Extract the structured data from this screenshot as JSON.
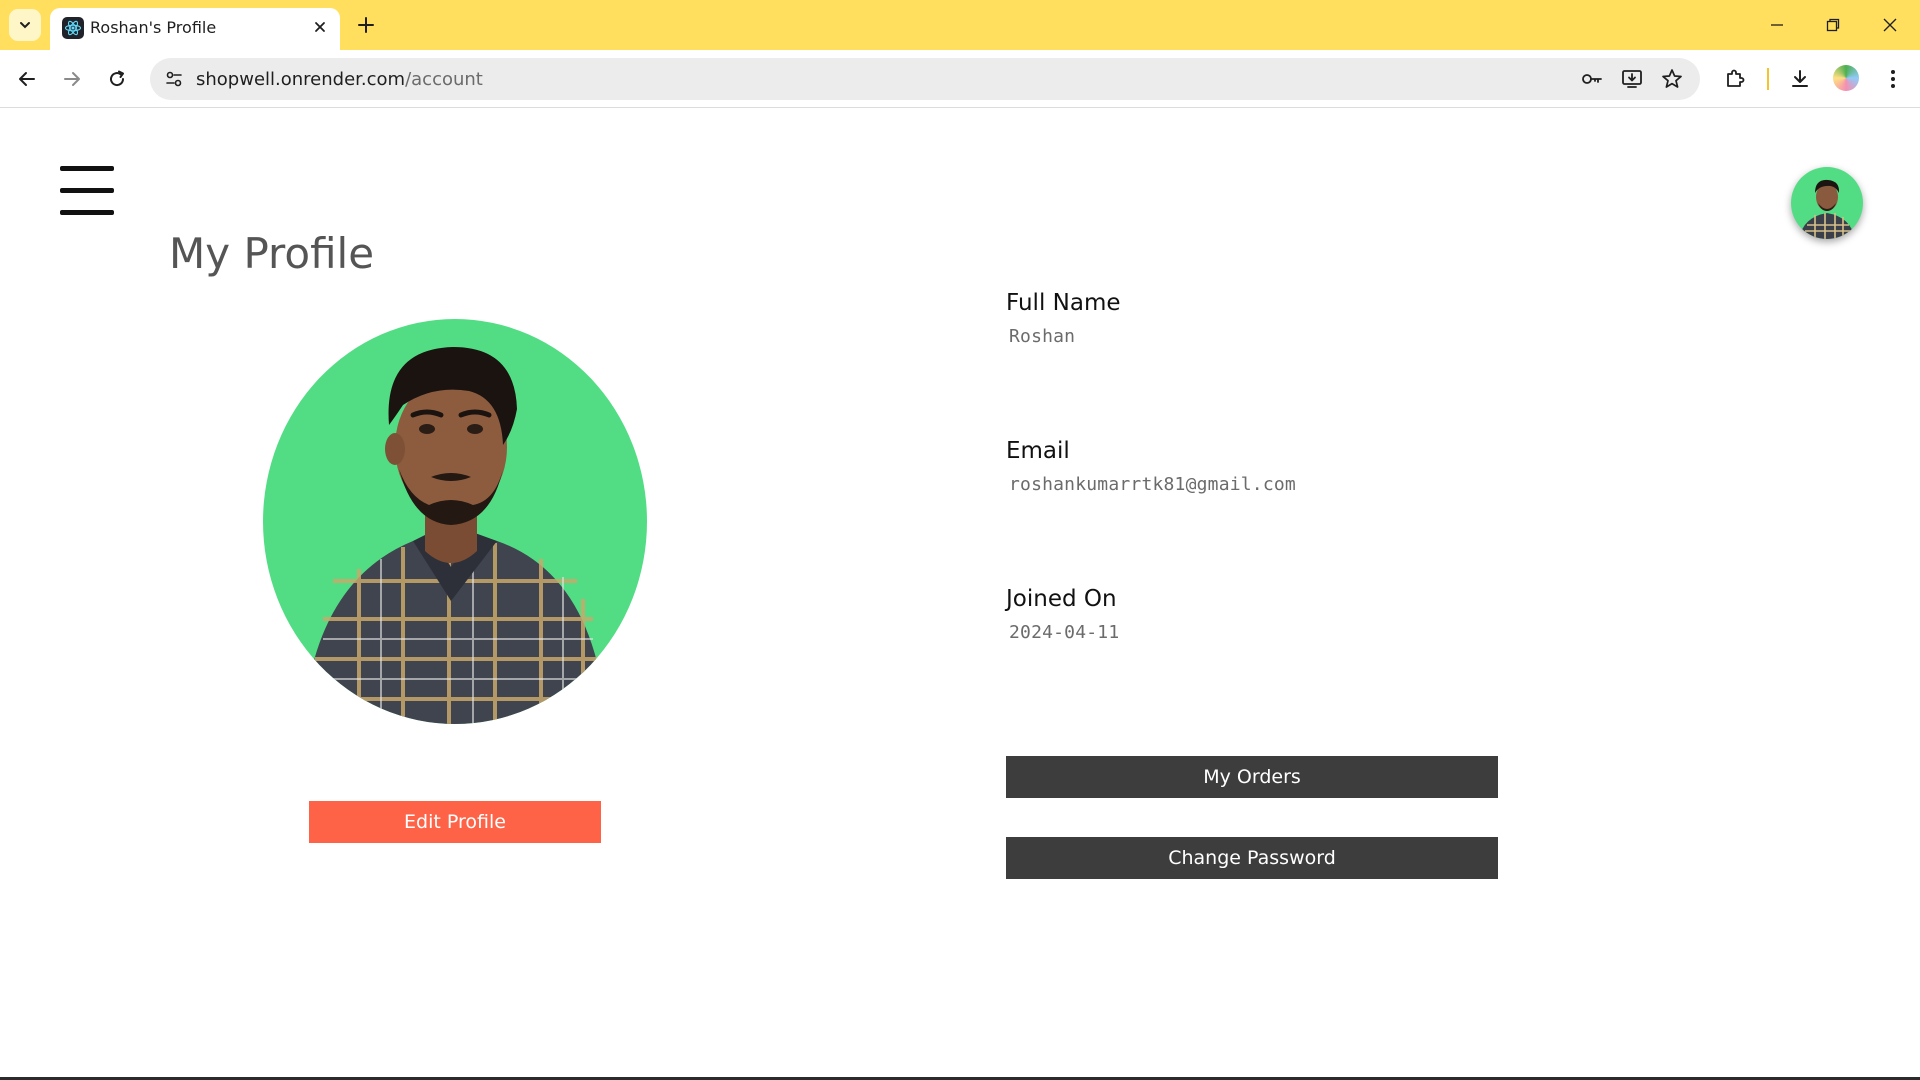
{
  "browser": {
    "tab_title": "Roshan's Profile",
    "url_host": "shopwell.onrender.com",
    "url_path": "/account",
    "accent_color": "#ffdf5d"
  },
  "page": {
    "title": "My Profile",
    "edit_button": "Edit Profile",
    "fields": [
      {
        "label": "Full Name",
        "value": "Roshan"
      },
      {
        "label": "Email",
        "value": "roshankumarrtk81@gmail.com"
      },
      {
        "label": "Joined On",
        "value": "2024-04-11"
      }
    ],
    "orders_button": "My Orders",
    "password_button": "Change Password",
    "colors": {
      "edit_button": "#ff6347",
      "dark_button": "#3d3d3d",
      "avatar_bg": "#52dd84"
    }
  }
}
